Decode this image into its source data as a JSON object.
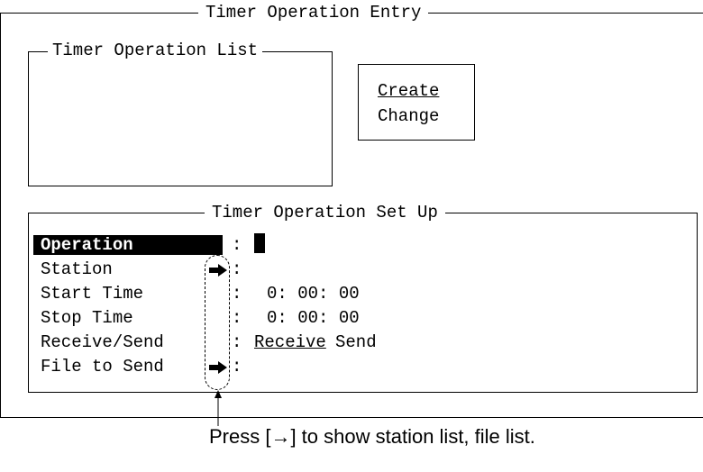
{
  "entry_window": {
    "title": "Timer Operation Entry"
  },
  "list_panel": {
    "title": "Timer Operation List"
  },
  "menu": {
    "create_label": "Create",
    "change_label": "Change"
  },
  "setup_panel": {
    "title": "Timer Operation Set Up",
    "fields": {
      "operation": {
        "label": "Operation",
        "colon": ":"
      },
      "station": {
        "label": "Station",
        "colon": ":"
      },
      "start_time": {
        "label": "Start Time",
        "colon": ":",
        "value": "0: 00: 00"
      },
      "stop_time": {
        "label": "Stop Time",
        "colon": ":",
        "value": "0: 00: 00"
      },
      "receive_send": {
        "label": "Receive/Send",
        "colon": ":",
        "option_receive": "Receive",
        "option_send": "Send"
      },
      "file_to_send": {
        "label": "File to Send",
        "colon": ":"
      }
    }
  },
  "icons": {
    "station_arrow": "right-arrow-icon",
    "file_arrow": "right-arrow-icon"
  },
  "callout": {
    "text": "Press [→] to show station list, file list."
  }
}
